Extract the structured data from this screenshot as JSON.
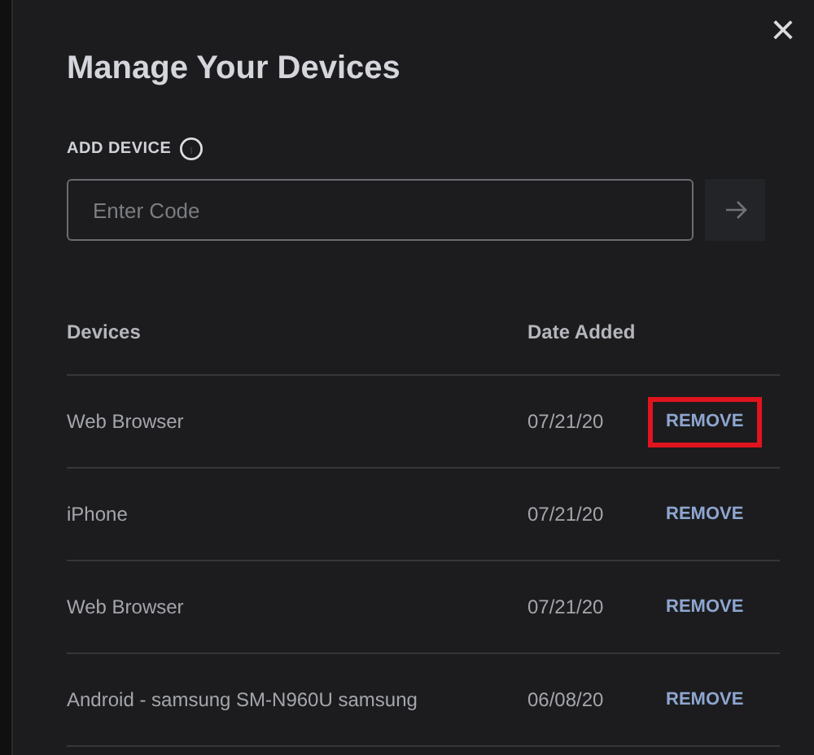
{
  "dialog": {
    "title": "Manage Your Devices",
    "close_label": "×"
  },
  "add_device": {
    "label": "ADD DEVICE",
    "placeholder": "Enter Code"
  },
  "table": {
    "columns": [
      "Devices",
      "Date Added"
    ],
    "rows": [
      {
        "device": "Web Browser",
        "date": "07/21/20",
        "action": "REMOVE",
        "highlighted": true
      },
      {
        "device": "iPhone",
        "date": "07/21/20",
        "action": "REMOVE",
        "highlighted": false
      },
      {
        "device": "Web Browser",
        "date": "07/21/20",
        "action": "REMOVE",
        "highlighted": false
      },
      {
        "device": "Android - samsung SM-N960U samsung",
        "date": "06/08/20",
        "action": "REMOVE",
        "highlighted": false
      }
    ]
  }
}
